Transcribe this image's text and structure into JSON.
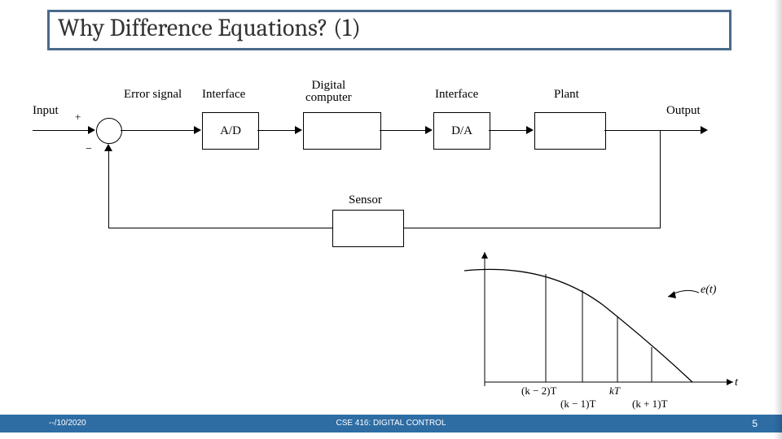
{
  "title": "Why Difference Equations? (1)",
  "diagram": {
    "input_label": "Input",
    "plus": "+",
    "minus": "−",
    "error_label": "Error signal",
    "interface1_label": "Interface",
    "ad_box": "A/D",
    "computer_label": "Digital\ncomputer",
    "interface2_label": "Interface",
    "da_box": "D/A",
    "plant_label": "Plant",
    "output_label": "Output",
    "sensor_label": "Sensor"
  },
  "plot": {
    "curve_label": "e(t)",
    "x_axis_label": "t",
    "ticks": {
      "km2_top": "(k − 2)T",
      "k_top": "kT",
      "km1_bot": "(k − 1)T",
      "kp1_bot": "(k + 1)T"
    }
  },
  "footer": {
    "date": "--/10/2020",
    "course": "CSE 416: DIGITAL CONTROL",
    "page": "5"
  }
}
